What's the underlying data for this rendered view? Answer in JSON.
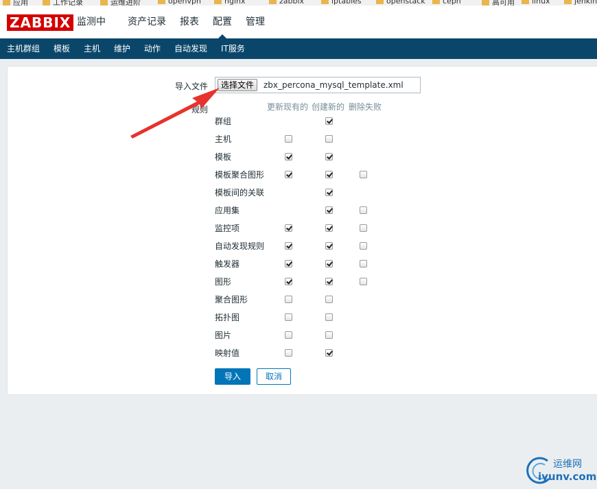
{
  "bookmarks": [
    {
      "label": "应用"
    },
    {
      "label": "工作记录"
    },
    {
      "label": "运维进阶"
    },
    {
      "label": "openvpn"
    },
    {
      "label": "nginx"
    },
    {
      "label": "zabbix"
    },
    {
      "label": "iptables"
    },
    {
      "label": "openstack"
    },
    {
      "label": "ceph"
    },
    {
      "label": "高可用"
    },
    {
      "label": "linux"
    },
    {
      "label": "jenkins"
    }
  ],
  "header": {
    "logo": "ZABBIX",
    "nav": [
      {
        "label": "监测中"
      },
      {
        "label": "资产记录"
      },
      {
        "label": "报表"
      },
      {
        "label": "配置",
        "active": true
      },
      {
        "label": "管理"
      }
    ]
  },
  "subnav": [
    {
      "label": "主机群组"
    },
    {
      "label": "模板"
    },
    {
      "label": "主机"
    },
    {
      "label": "维护"
    },
    {
      "label": "动作"
    },
    {
      "label": "自动发现"
    },
    {
      "label": "IT服务"
    }
  ],
  "form": {
    "import_file_label": "导入文件",
    "choose_file_button": "选择文件",
    "file_name": "zbx_percona_mysql_template.xml",
    "rules_label": "规则",
    "columns": [
      "更新现有的",
      "创建新的",
      "删除失败"
    ],
    "rules": [
      {
        "label": "群组",
        "update": null,
        "create": true,
        "delete": null
      },
      {
        "label": "主机",
        "update": false,
        "create": false,
        "delete": null
      },
      {
        "label": "模板",
        "update": true,
        "create": true,
        "delete": null
      },
      {
        "label": "模板聚合图形",
        "update": true,
        "create": true,
        "delete": false
      },
      {
        "label": "模板间的关联",
        "update": null,
        "create": true,
        "delete": null
      },
      {
        "label": "应用集",
        "update": null,
        "create": true,
        "delete": false
      },
      {
        "label": "监控项",
        "update": true,
        "create": true,
        "delete": false
      },
      {
        "label": "自动发现规则",
        "update": true,
        "create": true,
        "delete": false
      },
      {
        "label": "触发器",
        "update": true,
        "create": true,
        "delete": false
      },
      {
        "label": "图形",
        "update": true,
        "create": true,
        "delete": false
      },
      {
        "label": "聚合图形",
        "update": false,
        "create": false,
        "delete": null
      },
      {
        "label": "拓扑图",
        "update": false,
        "create": false,
        "delete": null
      },
      {
        "label": "图片",
        "update": false,
        "create": false,
        "delete": null
      },
      {
        "label": "映射值",
        "update": false,
        "create": true,
        "delete": null
      }
    ],
    "import_button": "导入",
    "cancel_button": "取消"
  },
  "annotation": {
    "arrow_color": "#e8322d"
  },
  "watermark": {
    "cn": "运维网",
    "en": "iyunv.com"
  }
}
